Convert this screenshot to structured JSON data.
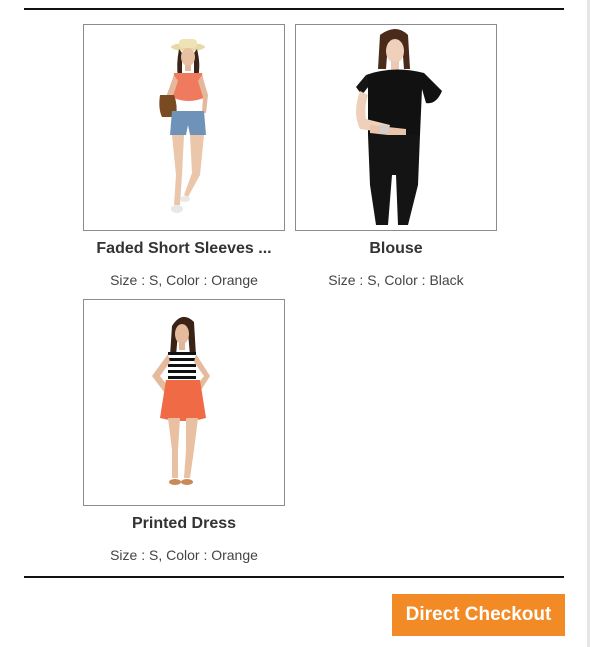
{
  "products": [
    {
      "name": "Faded Short Sleeves ...",
      "attributes": "Size : S, Color : Orange",
      "image": "woman-in-orange-top-and-denim-shorts-photo"
    },
    {
      "name": "Blouse",
      "attributes": "Size : S, Color : Black",
      "image": "woman-in-black-ruffle-blouse-photo"
    },
    {
      "name": "Printed Dress",
      "attributes": "Size : S, Color : Orange",
      "image": "woman-in-striped-top-and-orange-skirt-photo"
    }
  ],
  "checkout": {
    "label": "Direct Checkout",
    "color": "#f28a26"
  }
}
